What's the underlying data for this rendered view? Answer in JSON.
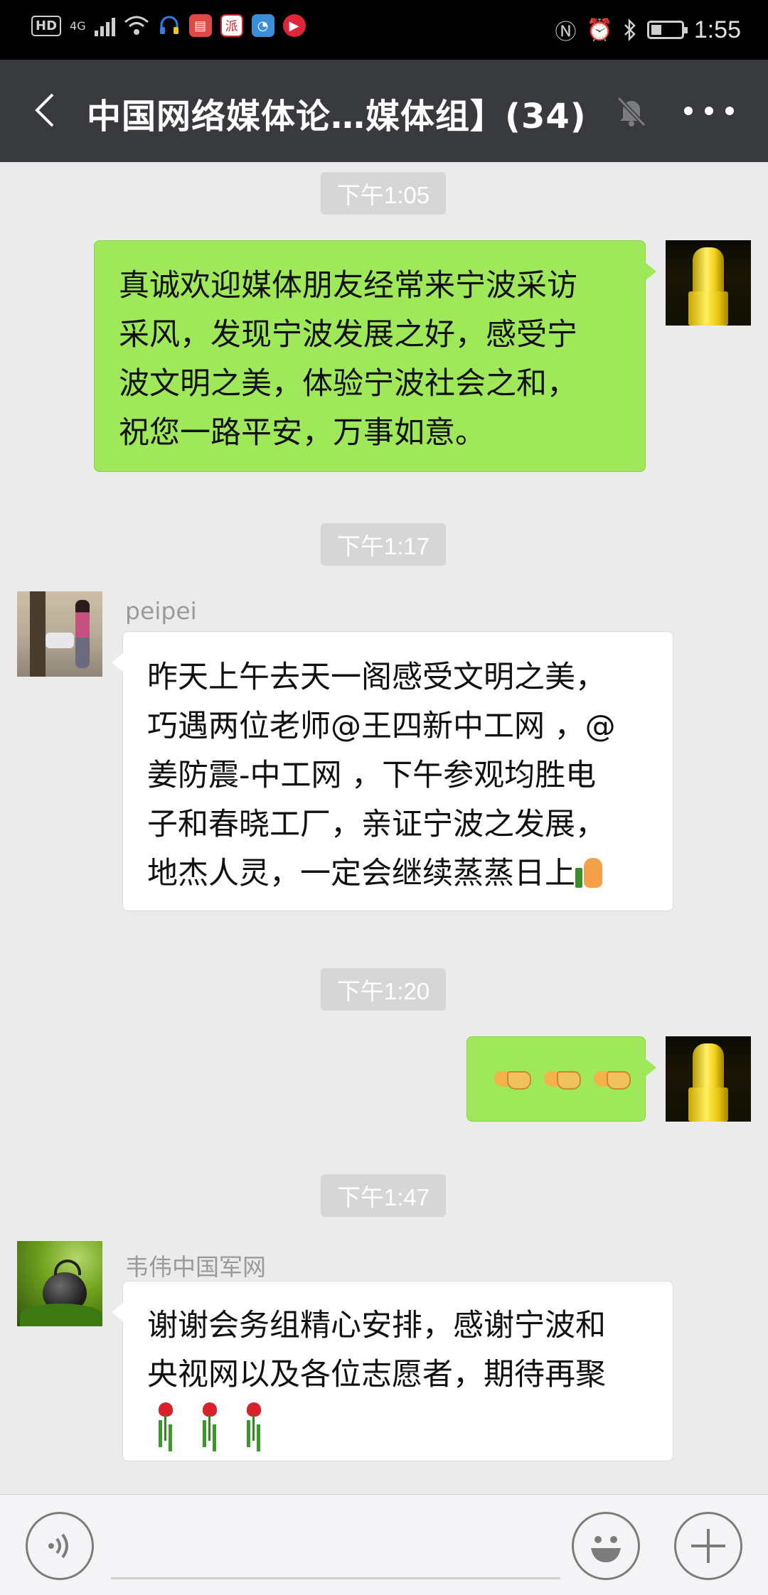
{
  "status_bar": {
    "hd_label": "HD",
    "network_label": "4G",
    "time": "1:55",
    "icons": [
      "hd-icon",
      "signal-icon",
      "wifi-icon",
      "headset-icon",
      "news-app-icon",
      "pai-app-icon",
      "browser-app-icon",
      "video-app-icon",
      "nfc-icon",
      "alarm-icon",
      "bluetooth-icon",
      "battery-icon"
    ],
    "pai_label": "派"
  },
  "header": {
    "title": "中国网络媒体论…媒体组】(34)",
    "icons": [
      "back-icon",
      "mute-bell-icon",
      "more-icon"
    ]
  },
  "messages": [
    {
      "time": "下午1:05",
      "direction": "sent",
      "lines": [
        "真诚欢迎媒体朋友经常来宁波采访",
        "采风，发现宁波发展之好，感受宁",
        "波文明之美，体验宁波社会之和，",
        "祝您一路平安，万事如意。"
      ]
    },
    {
      "time": "下午1:17",
      "direction": "received",
      "sender": "peipei",
      "lines": [
        "昨天上午去天一阁感受文明之美，",
        "巧遇两位老师@王四新中工网 ，@",
        "姜防震-中工网 ，下午参观均胜电",
        "子和春晓工厂，亲证宁波之发展，",
        "地杰人灵，一定会继续蒸蒸日上"
      ],
      "trailing_emoji": "thumbs-up"
    },
    {
      "time": "下午1:20",
      "direction": "sent",
      "emoji": [
        "handshake",
        "handshake",
        "handshake"
      ]
    },
    {
      "time": "下午1:47",
      "direction": "received",
      "sender": "韦伟中国军网",
      "lines": [
        "谢谢会务组精心安排，感谢宁波和",
        "央视网以及各位志愿者，期待再聚"
      ],
      "emoji": [
        "rose",
        "rose",
        "rose"
      ]
    }
  ],
  "input_bar": {
    "icons": [
      "voice-icon",
      "emoji-icon",
      "plus-icon"
    ]
  },
  "colors": {
    "sent_bubble": "#9fe85a",
    "received_bubble": "#ffffff",
    "header_bg": "#393a3e",
    "chat_bg": "#ebebeb"
  }
}
